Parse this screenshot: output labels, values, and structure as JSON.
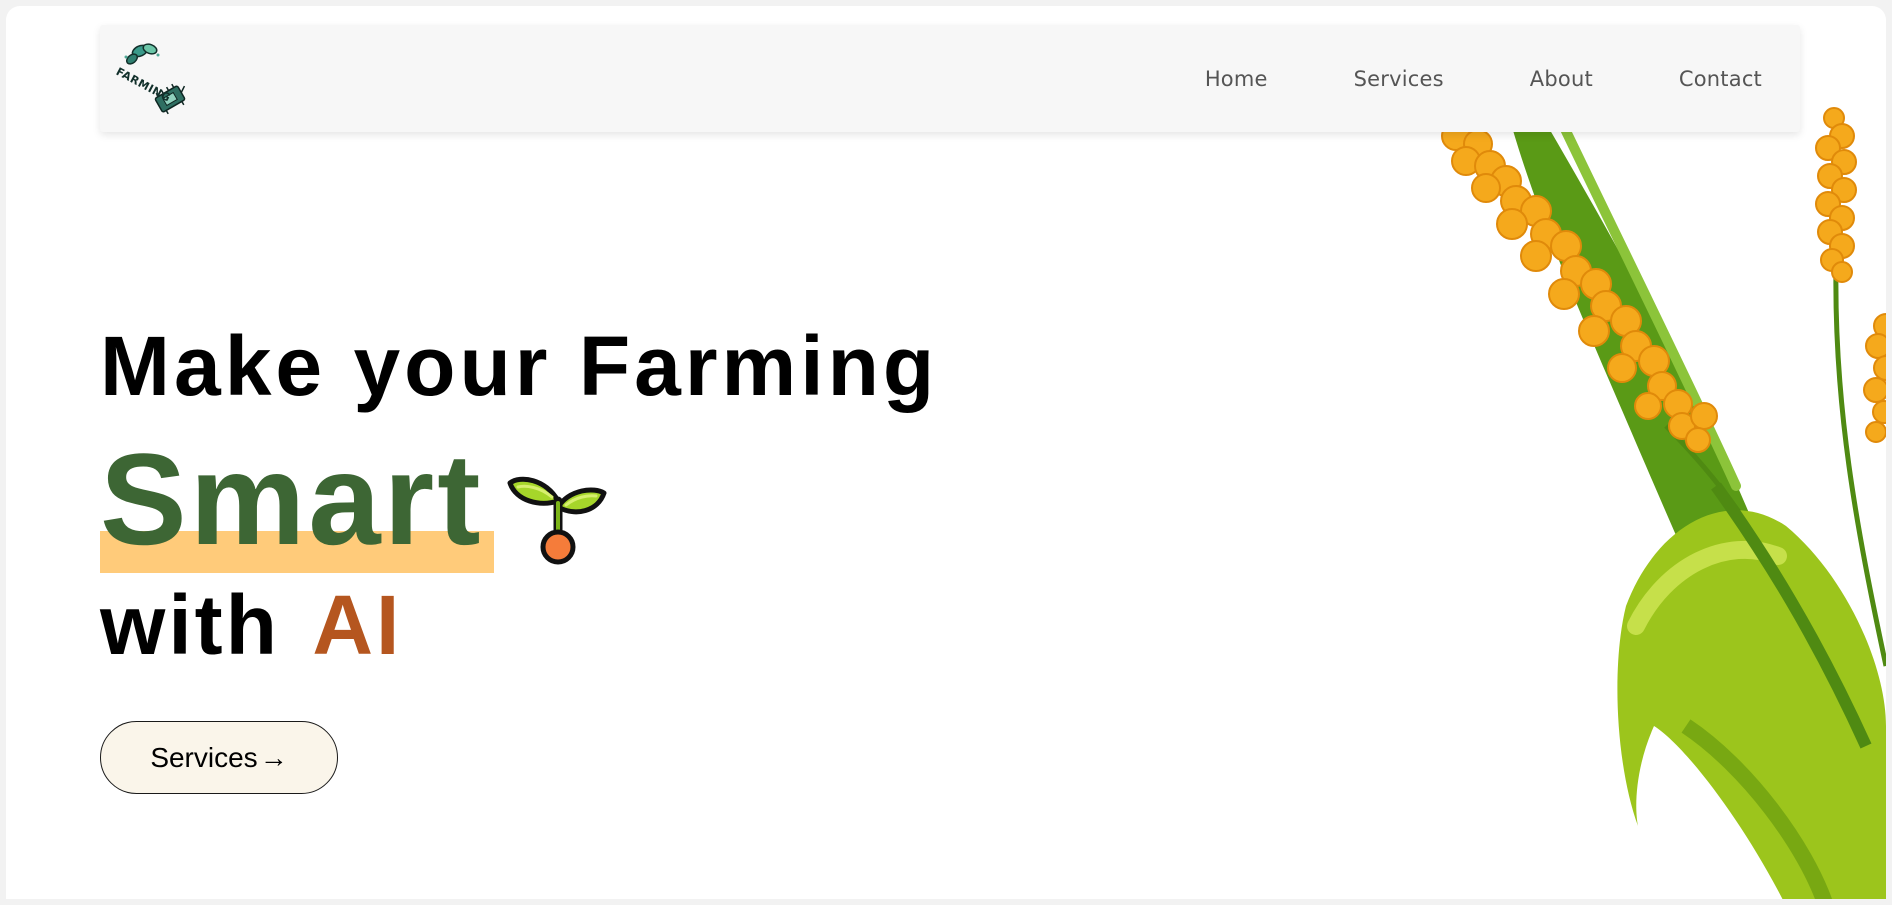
{
  "nav": {
    "logo_text": "FARMING",
    "links": [
      "Home",
      "Services",
      "About",
      "Contact"
    ]
  },
  "hero": {
    "line1": "Make your Farming",
    "smart": "Smart",
    "with": "with",
    "ai": "AI",
    "button_label": "Services",
    "button_arrow": "→"
  },
  "colors": {
    "smart_green": "#3d6634",
    "highlight": "#ffcb7a",
    "ai_brown": "#b5561f",
    "button_bg": "#faf5ea",
    "wheat_grain": "#f5a91c",
    "leaf_green": "#7cb518"
  }
}
